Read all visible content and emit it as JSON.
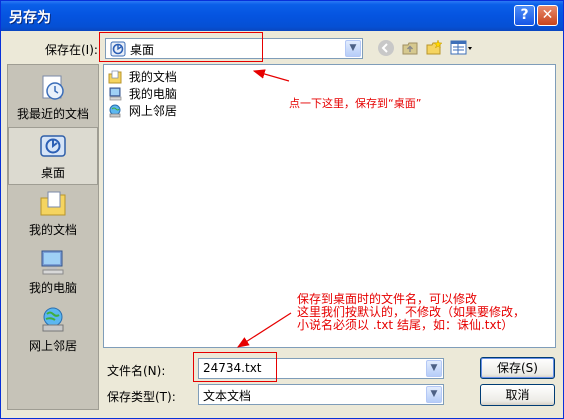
{
  "window": {
    "title": "另存为"
  },
  "title_buttons": {
    "help": "?",
    "close": "✕"
  },
  "save_in": {
    "label": "保存在(I):",
    "value": "桌面"
  },
  "places": [
    {
      "label": "我最近的文档",
      "icon": "recent-documents-icon"
    },
    {
      "label": "桌面",
      "icon": "desktop-icon"
    },
    {
      "label": "我的文档",
      "icon": "my-documents-icon"
    },
    {
      "label": "我的电脑",
      "icon": "my-computer-icon"
    },
    {
      "label": "网上邻居",
      "icon": "network-places-icon"
    }
  ],
  "files": [
    {
      "label": "我的文档",
      "icon": "my-documents-icon"
    },
    {
      "label": "我的电脑",
      "icon": "my-computer-icon"
    },
    {
      "label": "网上邻居",
      "icon": "network-places-icon"
    }
  ],
  "annotations": {
    "top": "点一下这里，保存到“桌面”",
    "bottom_line1": "保存到桌面时的文件名，可以修改",
    "bottom_line2": "这里我们按默认的，不修改（如果要修改，",
    "bottom_line3": "小说名必须以 .txt 结尾，如：诛仙.txt）"
  },
  "filename": {
    "label": "文件名(N):",
    "value": "24734.txt"
  },
  "filetype": {
    "label": "保存类型(T):",
    "value": "文本文档"
  },
  "buttons": {
    "save": "保存(S)",
    "cancel": "取消"
  },
  "colors": {
    "annotation": "#e60000",
    "titlebar": "#0554e0"
  }
}
